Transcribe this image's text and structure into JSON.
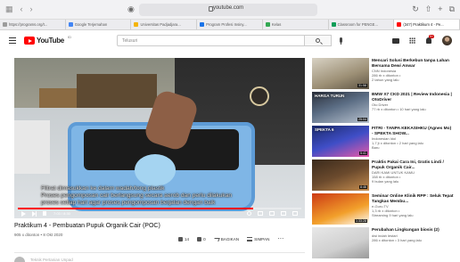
{
  "browser": {
    "url": "youtube.com",
    "tabs": [
      {
        "label": "https://programs.org/t...",
        "color": "#9b9b9b"
      },
      {
        "label": "Google Terjemahan",
        "color": "#4285f4"
      },
      {
        "label": "Universitas Padjadjara...",
        "color": "#f4b400"
      },
      {
        "label": "Program Profesi Insiny...",
        "color": "#1a73e8"
      },
      {
        "label": "Kelas",
        "color": "#34a853"
      },
      {
        "label": "Classroom for PENGE...",
        "color": "#0f9d58"
      },
      {
        "label": "(347) Praktikum 4 - Pe...",
        "color": "#ff0000"
      }
    ]
  },
  "header": {
    "logo_text": "YouTube",
    "region": "ID",
    "search_placeholder": "Telusuri",
    "notification_count": "9+"
  },
  "video": {
    "subtitles": [
      "Filtrat dimasukkan ke dalam wadah/tong plastik",
      "Proses pengomposan cair berlangsung secara aerob dan perlu dilakukan",
      "proses setiap hari agar proses pengomposan berjalan dengan baik"
    ],
    "time": "7:03 / 8:30",
    "progress": 0.83,
    "title": "Praktikum 4 - Pembuatan Pupuk Organik Cair (POC)",
    "meta": "905 x ditonton • 8 Okt 2020",
    "likes": "14",
    "dislikes": "0",
    "share_label": "BAGIKAN",
    "save_label": "SIMPAN",
    "channel_peek": "Teknik Pertanian Unpad"
  },
  "recommendations": [
    {
      "title": "Mencari Solusi Berkebun tanpa Lahan Bersama Dewi Anwar",
      "channel": "CNN Indonesia",
      "stats": "286 rb x ditonton •",
      "age": "2 tahun yang lalu",
      "duration": "31:58",
      "badge": ""
    },
    {
      "title": "BMW X7 CKD 2021 | Review Indonesia | OtoDriver",
      "channel": "Oto Driver",
      "stats": "77 rb x ditonton • 10 hari yang lalu",
      "age": "",
      "duration": "25:04",
      "badge": "HARGA TURUN"
    },
    {
      "title": "FITRI - TANPA KEKASIHKU (Agnes Mo) - SPEKTA SHOW...",
      "channel": "Indonesian Idol",
      "stats": "1,7 jt x ditonton • 2 hari yang lalu",
      "age": "Baru",
      "duration": "5:41",
      "badge": "SPEKTA 6"
    },
    {
      "title": "Praktis Pakai Cara Ini, Gratis Lindi / Pupuk Organik Cair...",
      "channel": "DARI KAMI UNTUK KAMU",
      "stats": "158 rb x ditonton •",
      "age": "9 bulan yang lalu",
      "duration": "8:46",
      "badge": ""
    },
    {
      "title": "Seminar Online Klinik RPP : Seluk Tepat Tangkas Membu...",
      "channel": "e-Guru.TV",
      "stats": "1,3 rb x ditonton •",
      "age": "Streaming 9 hari yang lalu",
      "duration": "1:33:28",
      "badge": ""
    },
    {
      "title": "Perubahan Lingkungan biosis (2)",
      "channel": "dwi indah lestari",
      "stats": "286 x ditonton • 3 hari yang lalu",
      "age": "",
      "duration": "",
      "badge": ""
    }
  ]
}
